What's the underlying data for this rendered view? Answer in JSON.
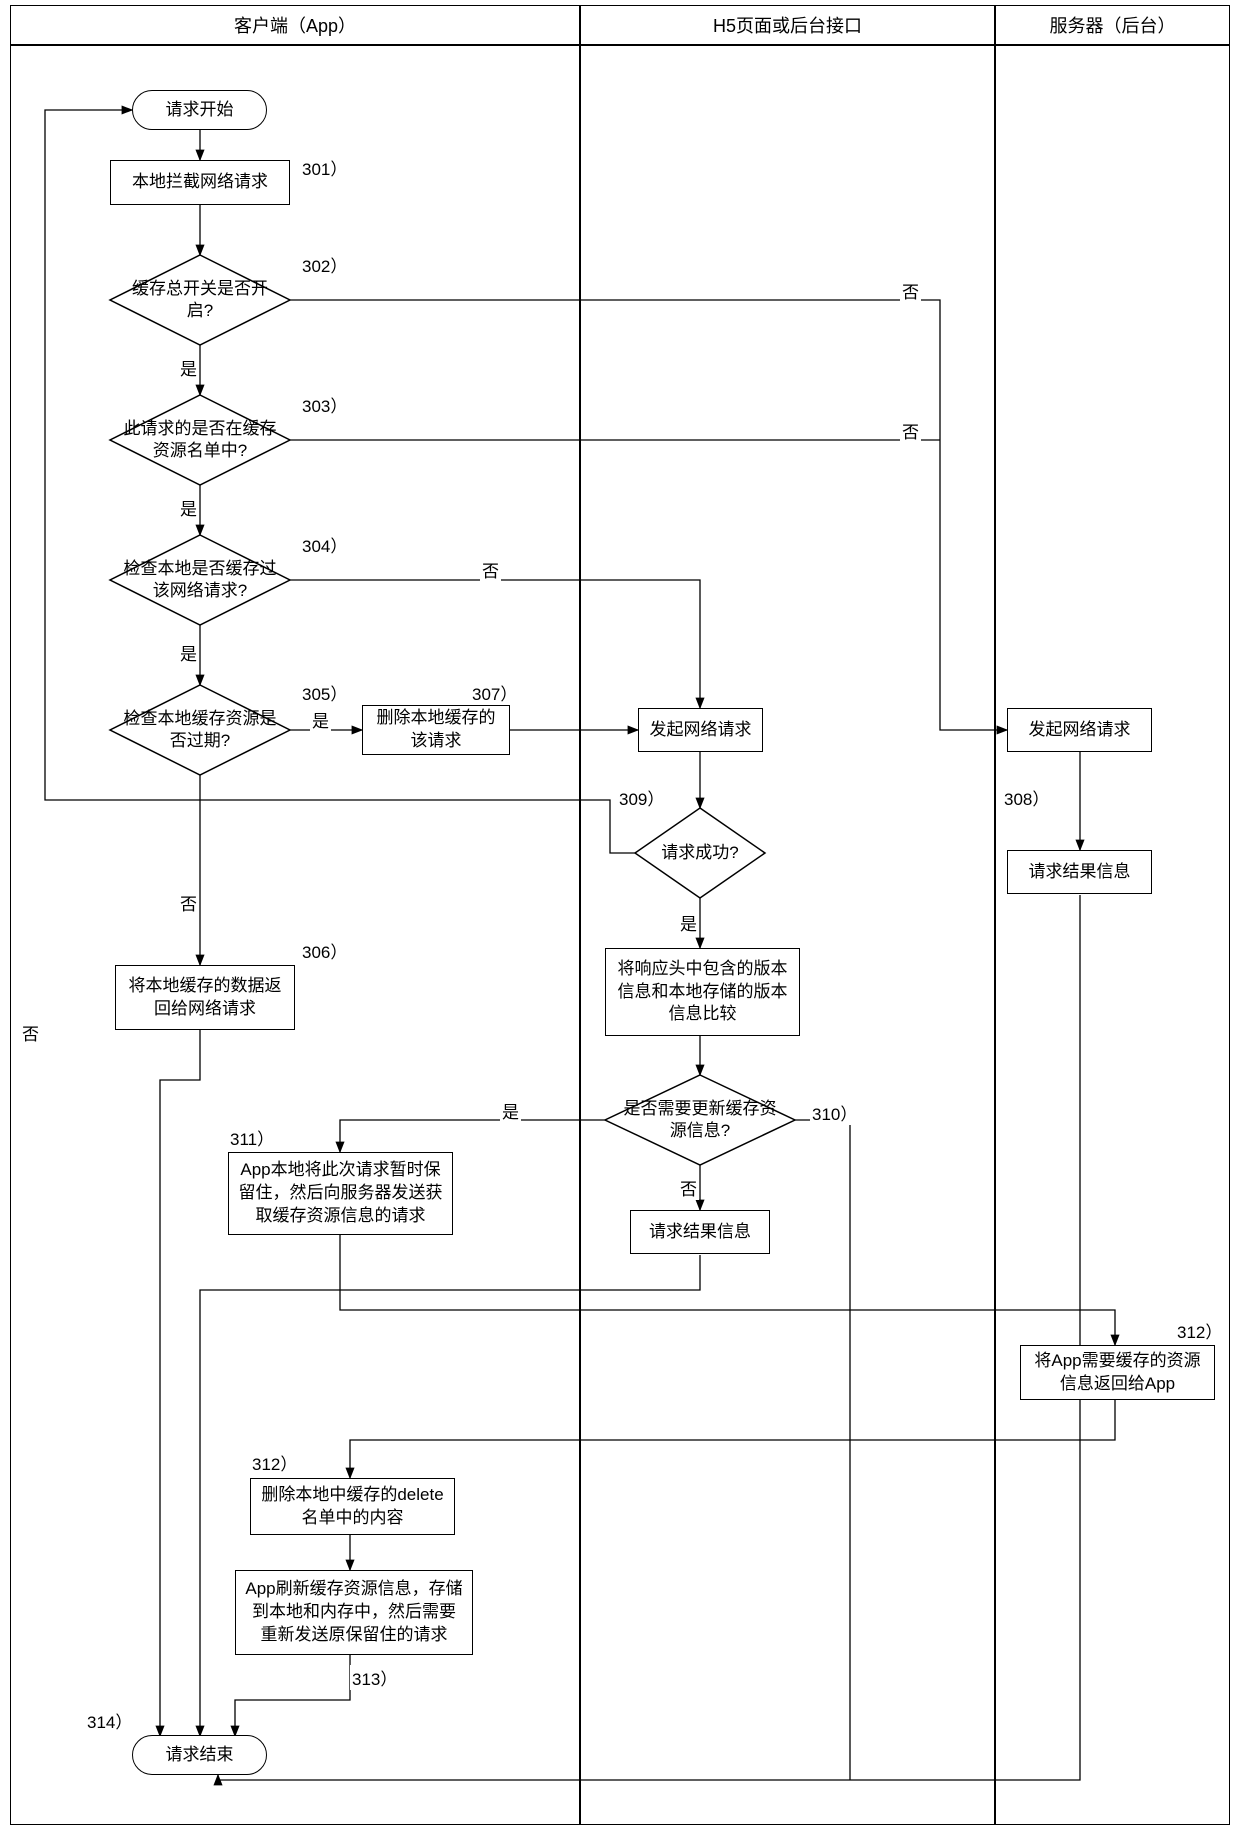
{
  "lanes": {
    "l1": "客户端（App）",
    "l2": "H5页面或后台接口",
    "l3": "服务器（后台）"
  },
  "nodes": {
    "start": "请求开始",
    "n301": "本地拦截网络请求",
    "n302": "缓存总开关是否开启?",
    "n303": "此请求的是否在缓存资源名单中?",
    "n304": "检查本地是否缓存过该网络请求?",
    "n305": "检查本地缓存资源是否过期?",
    "n306": "将本地缓存的数据返回给网络请求",
    "n307": "删除本地缓存的该请求",
    "n308_l2": "发起网络请求",
    "n308_l3": "发起网络请求",
    "n308_l3_result": "请求结果信息",
    "n309": "请求成功?",
    "n_compare": "将响应头中包含的版本信息和本地存储的版本信息比较",
    "n310": "是否需要更新缓存资源信息?",
    "n310_result": "请求结果信息",
    "n311": "App本地将此次请求暂时保留住，然后向服务器发送获取缓存资源信息的请求",
    "n312_l3": "将App需要缓存的资源信息返回给App",
    "n312_l1": "删除本地中缓存的delete名单中的内容",
    "n313": "App刷新缓存资源信息，存储到本地和内存中，然后需要重新发送原保留住的请求",
    "end": "请求结束"
  },
  "step_labels": {
    "s301": "301）",
    "s302": "302）",
    "s303": "303）",
    "s304": "304）",
    "s305": "305）",
    "s306": "306）",
    "s307": "307）",
    "s308": "308）",
    "s309": "309）",
    "s310": "310）",
    "s311": "311）",
    "s312a": "312）",
    "s312b": "312）",
    "s313": "313）",
    "s314": "314）"
  },
  "edge_labels": {
    "yes": "是",
    "no": "否"
  }
}
